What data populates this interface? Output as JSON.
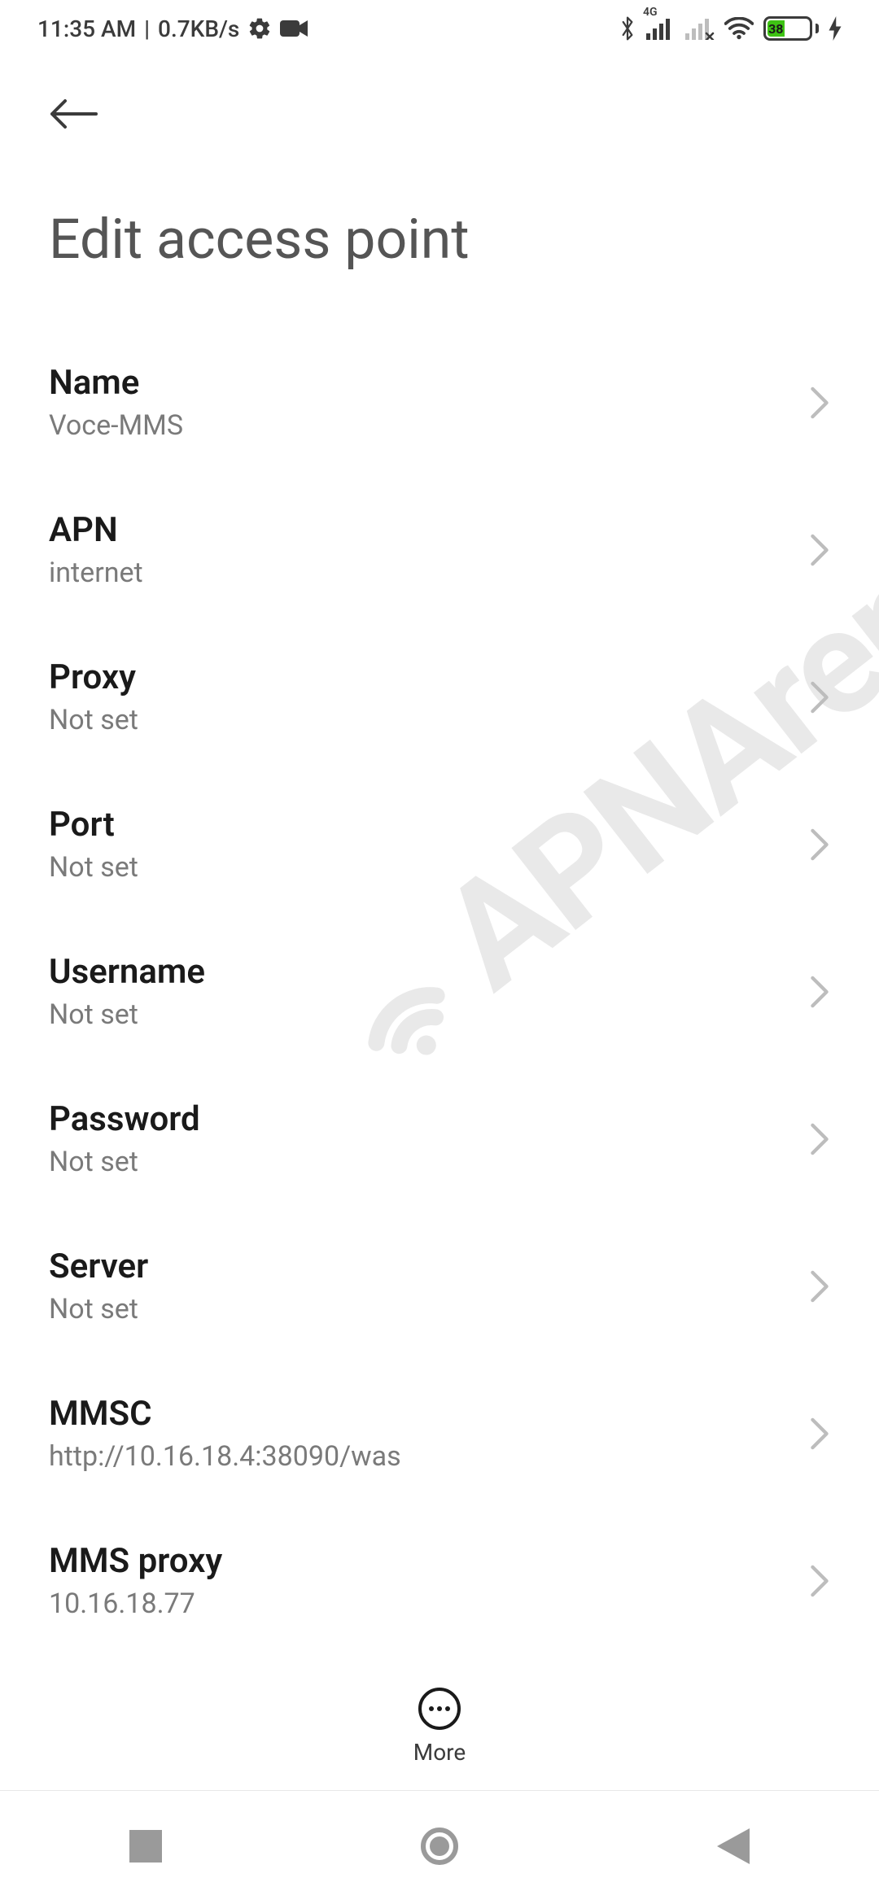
{
  "statusbar": {
    "time": "11:35 AM",
    "speed": "0.7KB/s",
    "mobile_gen": "4G",
    "battery_pct": "38"
  },
  "header": {
    "title": "Edit access point"
  },
  "rows": [
    {
      "title": "Name",
      "value": "Voce-MMS"
    },
    {
      "title": "APN",
      "value": "internet"
    },
    {
      "title": "Proxy",
      "value": "Not set"
    },
    {
      "title": "Port",
      "value": "Not set"
    },
    {
      "title": "Username",
      "value": "Not set"
    },
    {
      "title": "Password",
      "value": "Not set"
    },
    {
      "title": "Server",
      "value": "Not set"
    },
    {
      "title": "MMSC",
      "value": "http://10.16.18.4:38090/was"
    },
    {
      "title": "MMS proxy",
      "value": "10.16.18.77"
    }
  ],
  "footer": {
    "more_label": "More"
  },
  "watermark": "APNArena"
}
